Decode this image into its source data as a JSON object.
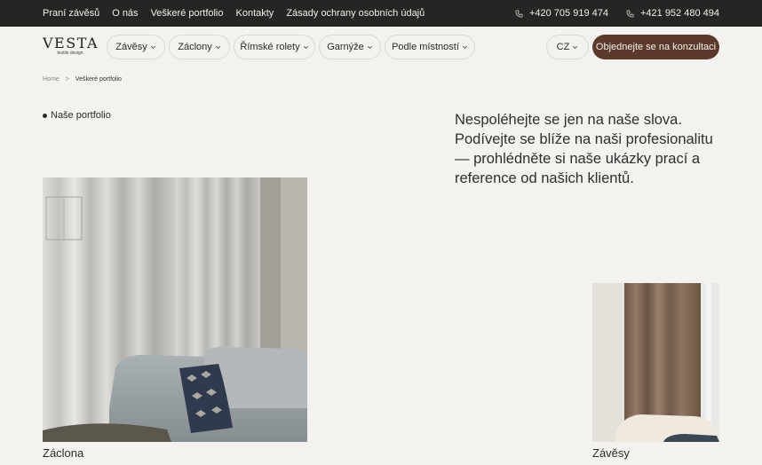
{
  "topbar": {
    "links": [
      "Praní závěsů",
      "O nás",
      "Veškeré portfolio",
      "Kontakty",
      "Zásady ochrany osobních údajů"
    ],
    "phones": [
      "+420 705 919 474",
      "+421 952 480 494"
    ]
  },
  "header": {
    "logo": {
      "name": "VESTA",
      "tagline": "textile design"
    },
    "nav": [
      "Závěsy",
      "Záclony",
      "Římské rolety",
      "Garnýže",
      "Podle místností"
    ],
    "lang": "CZ",
    "cta": "Objednejte se na konzultaci"
  },
  "breadcrumb": {
    "home": "Home",
    "separator": ">",
    "current": "Veškeré portfolio"
  },
  "main": {
    "section_label": "Naše portfolio",
    "intro": "Nespoléhejte se jen na naše slova. Podívejte se blíže na naši profesionalitu — prohlédněte si naše ukázky prací a reference od našich klientů.",
    "items": [
      {
        "caption": "Záclona"
      },
      {
        "caption": "Závěsy"
      }
    ]
  },
  "colors": {
    "topbar": "#262523",
    "background": "#f3f2ee",
    "accent": "#5b3a2c"
  }
}
